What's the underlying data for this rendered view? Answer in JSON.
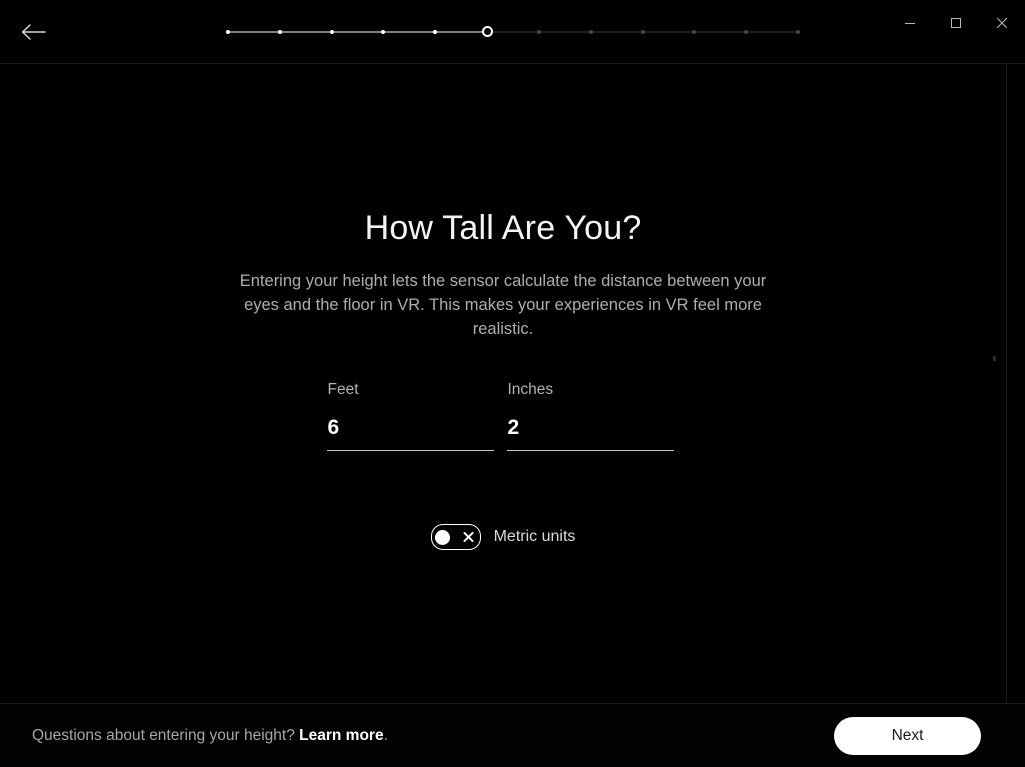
{
  "window": {
    "title": "How Tall Are You?",
    "back_icon": "arrow-left-icon",
    "controls": {
      "minimize_label": "Minimize",
      "maximize_label": "Maximize",
      "close_label": "Close"
    }
  },
  "progress": {
    "total_steps": 12,
    "current_step": 6,
    "completed_color": "#ffffff",
    "pending_color": "#4a4a4a",
    "steps": [
      {
        "index": 1,
        "state": "done"
      },
      {
        "index": 2,
        "state": "done"
      },
      {
        "index": 3,
        "state": "done"
      },
      {
        "index": 4,
        "state": "done"
      },
      {
        "index": 5,
        "state": "done"
      },
      {
        "index": 6,
        "state": "current"
      },
      {
        "index": 7,
        "state": "todo"
      },
      {
        "index": 8,
        "state": "todo"
      },
      {
        "index": 9,
        "state": "todo"
      },
      {
        "index": 10,
        "state": "todo"
      },
      {
        "index": 11,
        "state": "todo"
      },
      {
        "index": 12,
        "state": "todo"
      }
    ]
  },
  "main": {
    "title": "How Tall Are You?",
    "description": "Entering your height lets the sensor calculate the distance between your eyes and the floor in VR. This makes your experiences in VR feel more realistic.",
    "fields": [
      {
        "name": "feet",
        "label": "Feet",
        "value": "6",
        "placeholder": "0"
      },
      {
        "name": "inches",
        "label": "Inches",
        "value": "2",
        "placeholder": "0"
      }
    ],
    "metric_toggle": {
      "label": "Metric units",
      "state": "off",
      "off_icon": "close-x-icon"
    }
  },
  "footer": {
    "help_text": "Questions about entering your height? ",
    "link_text": "Learn more",
    "help_suffix": ".",
    "next_label": "Next"
  },
  "theme": {
    "background": "#000000",
    "text_primary": "#ffffff",
    "text_secondary": "#b0aeab",
    "accent_button": "#ffffff",
    "divider": "#1b1b1b"
  }
}
